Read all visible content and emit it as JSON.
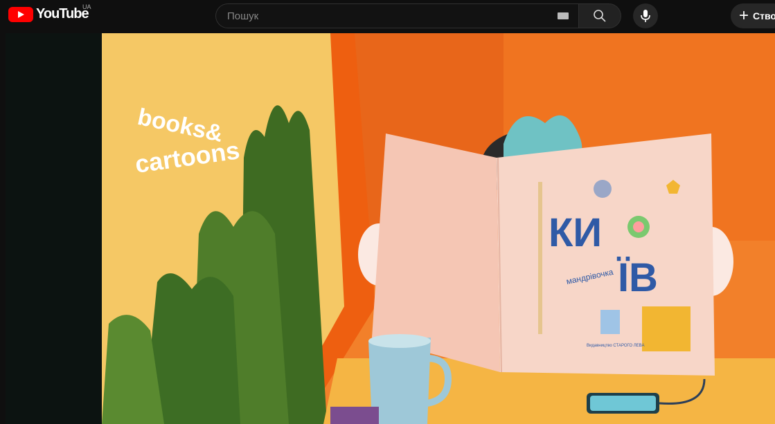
{
  "header": {
    "logo_text": "YouTube",
    "country_code": "UA",
    "search_placeholder": "Пошук",
    "create_label": "Ство"
  },
  "icons": {
    "logo": "youtube-play-icon",
    "keyboard": "keyboard-icon",
    "search": "search-icon",
    "mic": "microphone-icon",
    "create": "plus-icon"
  },
  "video": {
    "overlay_text_line1": "books&",
    "overlay_text_line2": "cartoons",
    "book_title_top": "КИ",
    "book_title_bottom": "ЇВ",
    "book_subtitle": "мандрівочка",
    "publisher": "Видавництво СТАРОГО ЛЕВА"
  },
  "colors": {
    "youtube_red": "#ff0000",
    "background": "#0f0f0f",
    "orange": "#ee6a12",
    "sand": "#f7c45e",
    "book_pink": "#f7d6c8",
    "title_blue": "#2f5aa6"
  }
}
